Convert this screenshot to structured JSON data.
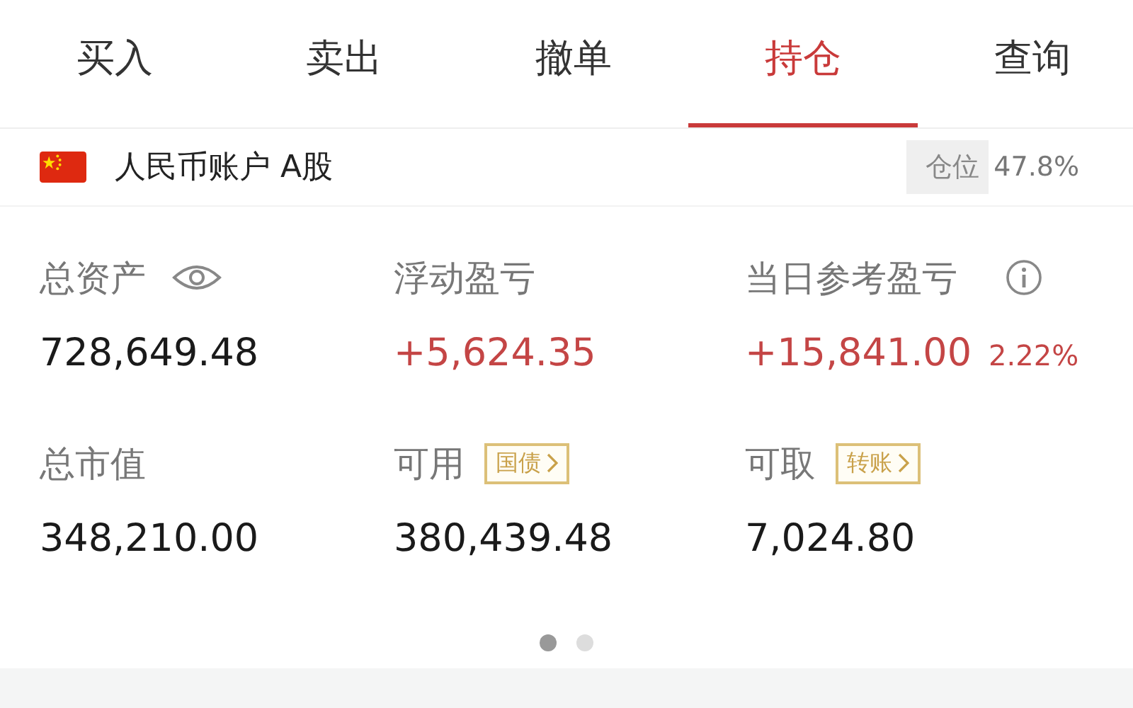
{
  "tabs": [
    {
      "label": "买入",
      "selected": false
    },
    {
      "label": "卖出",
      "selected": false
    },
    {
      "label": "撤单",
      "selected": false
    },
    {
      "label": "持仓",
      "selected": true
    },
    {
      "label": "查询",
      "selected": false
    }
  ],
  "account": {
    "name": "人民币账户 A股",
    "position_label": "仓位",
    "position_value": "47.8%"
  },
  "metrics": [
    {
      "label": "总资产",
      "kind": "eye",
      "value": "728,649.48",
      "gain": false
    },
    {
      "label": "浮动盈亏",
      "kind": "plain",
      "value": "+5,624.35",
      "gain": true
    },
    {
      "label": "当日参考盈亏",
      "kind": "info",
      "value": "+15,841.00",
      "percent": "2.22%",
      "gain": true
    },
    {
      "label": "总市值",
      "kind": "plain",
      "value": "348,210.00",
      "gain": false
    },
    {
      "label": "可用",
      "kind": "badge",
      "badge": "国债",
      "value": "380,439.48",
      "gain": false
    },
    {
      "label": "可取",
      "kind": "badge",
      "badge": "转账",
      "value": "7,024.80",
      "gain": false
    }
  ],
  "pager": [
    {
      "selected": true
    },
    {
      "selected": false
    }
  ]
}
